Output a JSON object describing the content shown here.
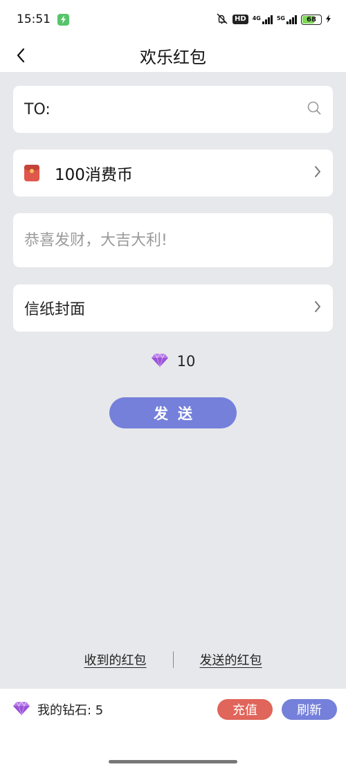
{
  "status_bar": {
    "time": "15:51",
    "hd": "HD",
    "network_1": "4G",
    "network_2": "5G",
    "battery": "68",
    "battery_level": 0.68
  },
  "nav": {
    "title": "欢乐红包",
    "back_icon": "chevron-left-icon"
  },
  "recipient": {
    "label": "TO:",
    "search_icon": "search-icon"
  },
  "amount": {
    "text": "100消费币",
    "icon": "red-envelope-icon"
  },
  "message": {
    "placeholder": "恭喜发财，大吉大利!"
  },
  "cover": {
    "label": "信纸封面"
  },
  "cost": {
    "value": "10",
    "icon": "diamond-icon"
  },
  "send_button": {
    "label": "发送"
  },
  "links": {
    "received": "收到的红包",
    "sent": "发送的红包"
  },
  "footer": {
    "balance_label": "我的钻石: 5",
    "recharge": "充值",
    "refresh": "刷新"
  },
  "colors": {
    "accent": "#7480da",
    "recharge": "#e0655a",
    "envelope": "#e0574c",
    "background": "#e7e8ec"
  }
}
